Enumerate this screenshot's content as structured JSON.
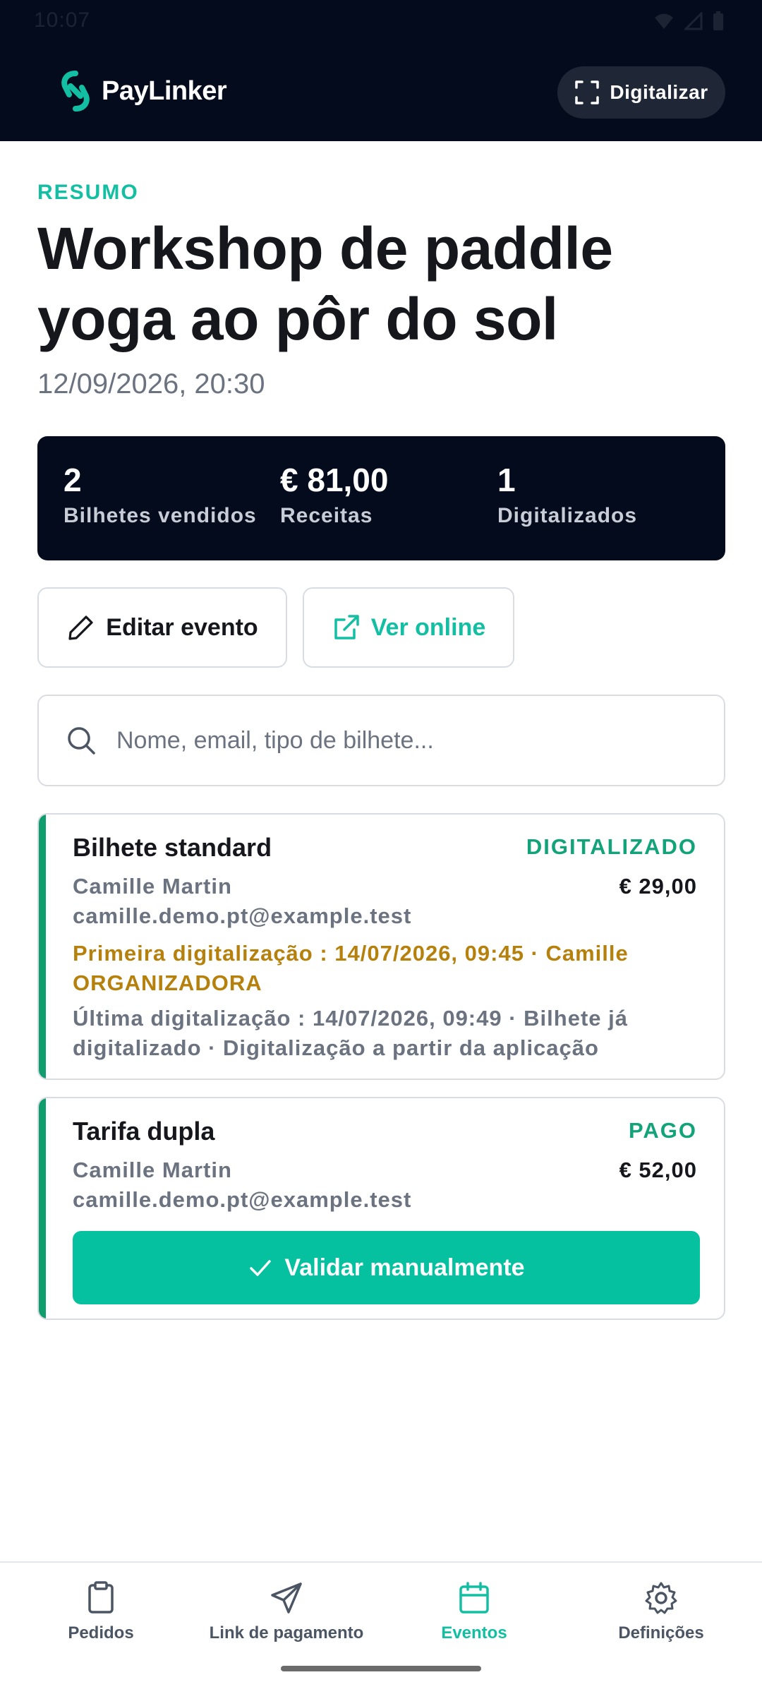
{
  "status_bar": {
    "time": "10:07"
  },
  "app": {
    "brand": "PayLinker",
    "scan_label": "Digitalizar"
  },
  "event": {
    "overline": "RESUMO",
    "title": "Workshop de paddle yoga ao pôr do sol",
    "date": "12/09/2026, 20:30"
  },
  "stats": [
    {
      "value": "2",
      "label": "Bilhetes vendidos"
    },
    {
      "value": "€ 81,00",
      "label": "Receitas"
    },
    {
      "value": "1",
      "label": "Digitalizados"
    }
  ],
  "actions": {
    "edit_label": "Editar evento",
    "online_label": "Ver online"
  },
  "search": {
    "placeholder": "Nome, email, tipo de bilhete...",
    "value": ""
  },
  "tickets": [
    {
      "type": "Bilhete standard",
      "status": "DIGITALIZADO",
      "name": "Camille Martin",
      "email": "camille.demo.pt@example.test",
      "price": "€ 29,00",
      "first_scan": "Primeira digitalização : 14/07/2026, 09:45 · Camille ORGANIZADORA",
      "last_scan": "Última digitalização : 14/07/2026, 09:49 · Bilhete já digitalizado · Digitalização a partir da aplicação"
    },
    {
      "type": "Tarifa dupla",
      "status": "PAGO",
      "name": "Camille Martin",
      "email": "camille.demo.pt@example.test",
      "price": "€ 52,00",
      "action_label": "Validar manualmente"
    }
  ],
  "nav": [
    {
      "label": "Pedidos",
      "icon": "clipboard-icon",
      "active": false
    },
    {
      "label": "Link de pagamento",
      "icon": "send-icon",
      "active": false
    },
    {
      "label": "Eventos",
      "icon": "calendar-icon",
      "active": true
    },
    {
      "label": "Definições",
      "icon": "gear-icon",
      "active": false
    }
  ],
  "colors": {
    "header_bg": "#040b1c",
    "accent": "#13bfa2",
    "scanned_bar": "#0f9d6e",
    "warning_text": "#b6800d",
    "validate_btn": "#05c19f"
  }
}
